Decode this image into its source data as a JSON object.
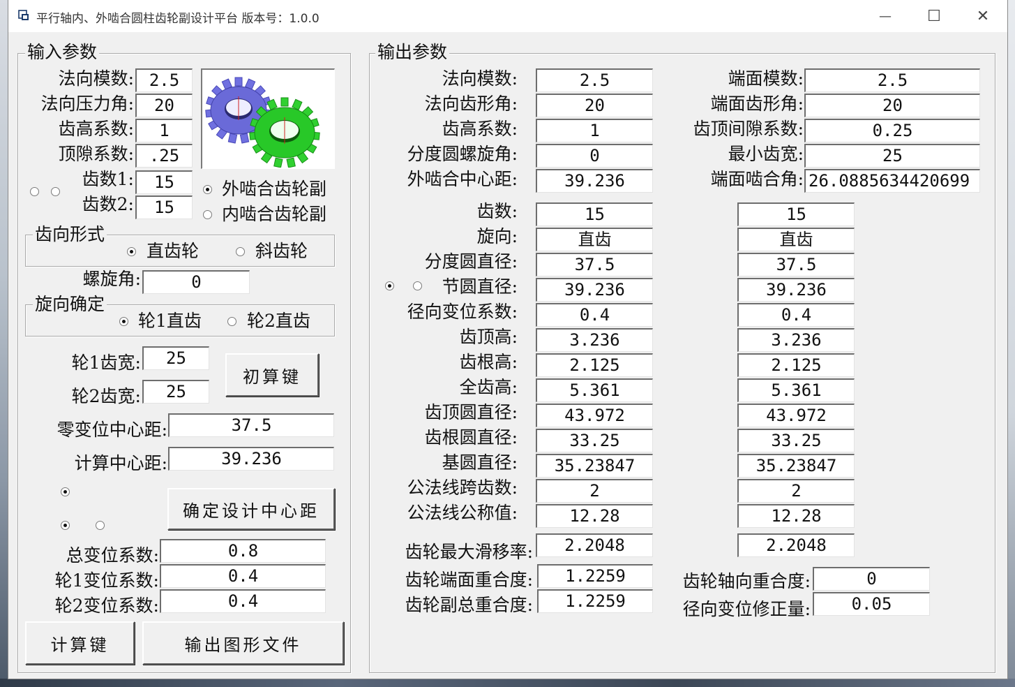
{
  "window": {
    "title": "平行轴内、外啮合圆柱齿轮副设计平台 版本号：1.0.0",
    "minimize_glyph": "—",
    "maximize_glyph": "☐",
    "close_glyph": "✕"
  },
  "input": {
    "group_title": "输入参数",
    "normal_module_label": "法向模数:",
    "normal_module_value": "2.5",
    "pressure_angle_label": "法向压力角:",
    "pressure_angle_value": "20",
    "addendum_coef_label": "齿高系数:",
    "addendum_coef_value": "1",
    "clearance_coef_label": "顶隙系数:",
    "clearance_coef_value": ".25",
    "teeth1_label": "齿数1:",
    "teeth1_value": "15",
    "teeth2_label": "齿数2:",
    "teeth2_value": "15",
    "external_gear_label": "外啮合齿轮副",
    "internal_gear_label": "内啮合齿轮副",
    "tooth_form_title": "齿向形式",
    "spur_label": "直齿轮",
    "helical_label": "斜齿轮",
    "helix_angle_label": "螺旋角:",
    "helix_angle_value": "0",
    "direction_title": "旋向确定",
    "gear1_spur_label": "轮1直齿",
    "gear2_spur_label": "轮2直齿",
    "gear1_width_label": "轮1齿宽:",
    "gear1_width_value": "25",
    "gear2_width_label": "轮2齿宽:",
    "gear2_width_value": "25",
    "initial_calc_button": "初算键",
    "zero_shift_center_label": "零变位中心距:",
    "zero_shift_center_value": "37.5",
    "calc_center_label": "计算中心距:",
    "calc_center_value": "39.236",
    "confirm_center_button": "确定设计中心距",
    "total_shift_label": "总变位系数:",
    "total_shift_value": "0.8",
    "shift1_label": "轮1变位系数:",
    "shift1_value": "0.4",
    "shift2_label": "轮2变位系数:",
    "shift2_value": "0.4",
    "calc_button": "计算键",
    "export_button": "输出图形文件"
  },
  "output": {
    "group_title": "输出参数",
    "normal_module_label": "法向模数:",
    "normal_module_value": "2.5",
    "normal_profile_angle_label": "法向齿形角:",
    "normal_profile_angle_value": "20",
    "addendum_coef_label": "齿高系数:",
    "addendum_coef_value": "1",
    "helix_angle_label": "分度圆螺旋角:",
    "helix_angle_value": "0",
    "center_distance_label": "外啮合中心距:",
    "center_distance_value": "39.236",
    "transverse_module_label": "端面模数:",
    "transverse_module_value": "2.5",
    "transverse_profile_angle_label": "端面齿形角:",
    "transverse_profile_angle_value": "20",
    "tip_clearance_label": "齿顶间隙系数:",
    "tip_clearance_value": "0.25",
    "min_width_label": "最小齿宽:",
    "min_width_value": "25",
    "transverse_mesh_angle_label": "端面啮合角:",
    "transverse_mesh_angle_value": "26.0885634420699",
    "rows": [
      {
        "label": "齿数:",
        "g1": "15",
        "g2": "15"
      },
      {
        "label": "旋向:",
        "g1": "直齿",
        "g2": "直齿"
      },
      {
        "label": "分度圆直径:",
        "g1": "37.5",
        "g2": "37.5"
      },
      {
        "label": "节圆直径:",
        "g1": "39.236",
        "g2": "39.236"
      },
      {
        "label": "径向变位系数:",
        "g1": "0.4",
        "g2": "0.4"
      },
      {
        "label": "齿顶高:",
        "g1": "3.236",
        "g2": "3.236"
      },
      {
        "label": "齿根高:",
        "g1": "2.125",
        "g2": "2.125"
      },
      {
        "label": "全齿高:",
        "g1": "5.361",
        "g2": "5.361"
      },
      {
        "label": "齿顶圆直径:",
        "g1": "43.972",
        "g2": "43.972"
      },
      {
        "label": "齿根圆直径:",
        "g1": "33.25",
        "g2": "33.25"
      },
      {
        "label": "基圆直径:",
        "g1": "35.23847",
        "g2": "35.23847"
      },
      {
        "label": "公法线跨齿数:",
        "g1": "2",
        "g2": "2"
      },
      {
        "label": "公法线公称值:",
        "g1": "12.28",
        "g2": "12.28"
      }
    ],
    "max_slip_label": "齿轮最大滑移率:",
    "max_slip_g1": "2.2048",
    "max_slip_g2": "2.2048",
    "transverse_contact_label": "齿轮端面重合度:",
    "transverse_contact_value": "1.2259",
    "total_contact_label": "齿轮副总重合度:",
    "total_contact_value": "1.2259",
    "axial_contact_label": "齿轮轴向重合度:",
    "axial_contact_value": "0",
    "radial_shift_correction_label": "径向变位修正量:",
    "radial_shift_correction_value": "0.05"
  }
}
